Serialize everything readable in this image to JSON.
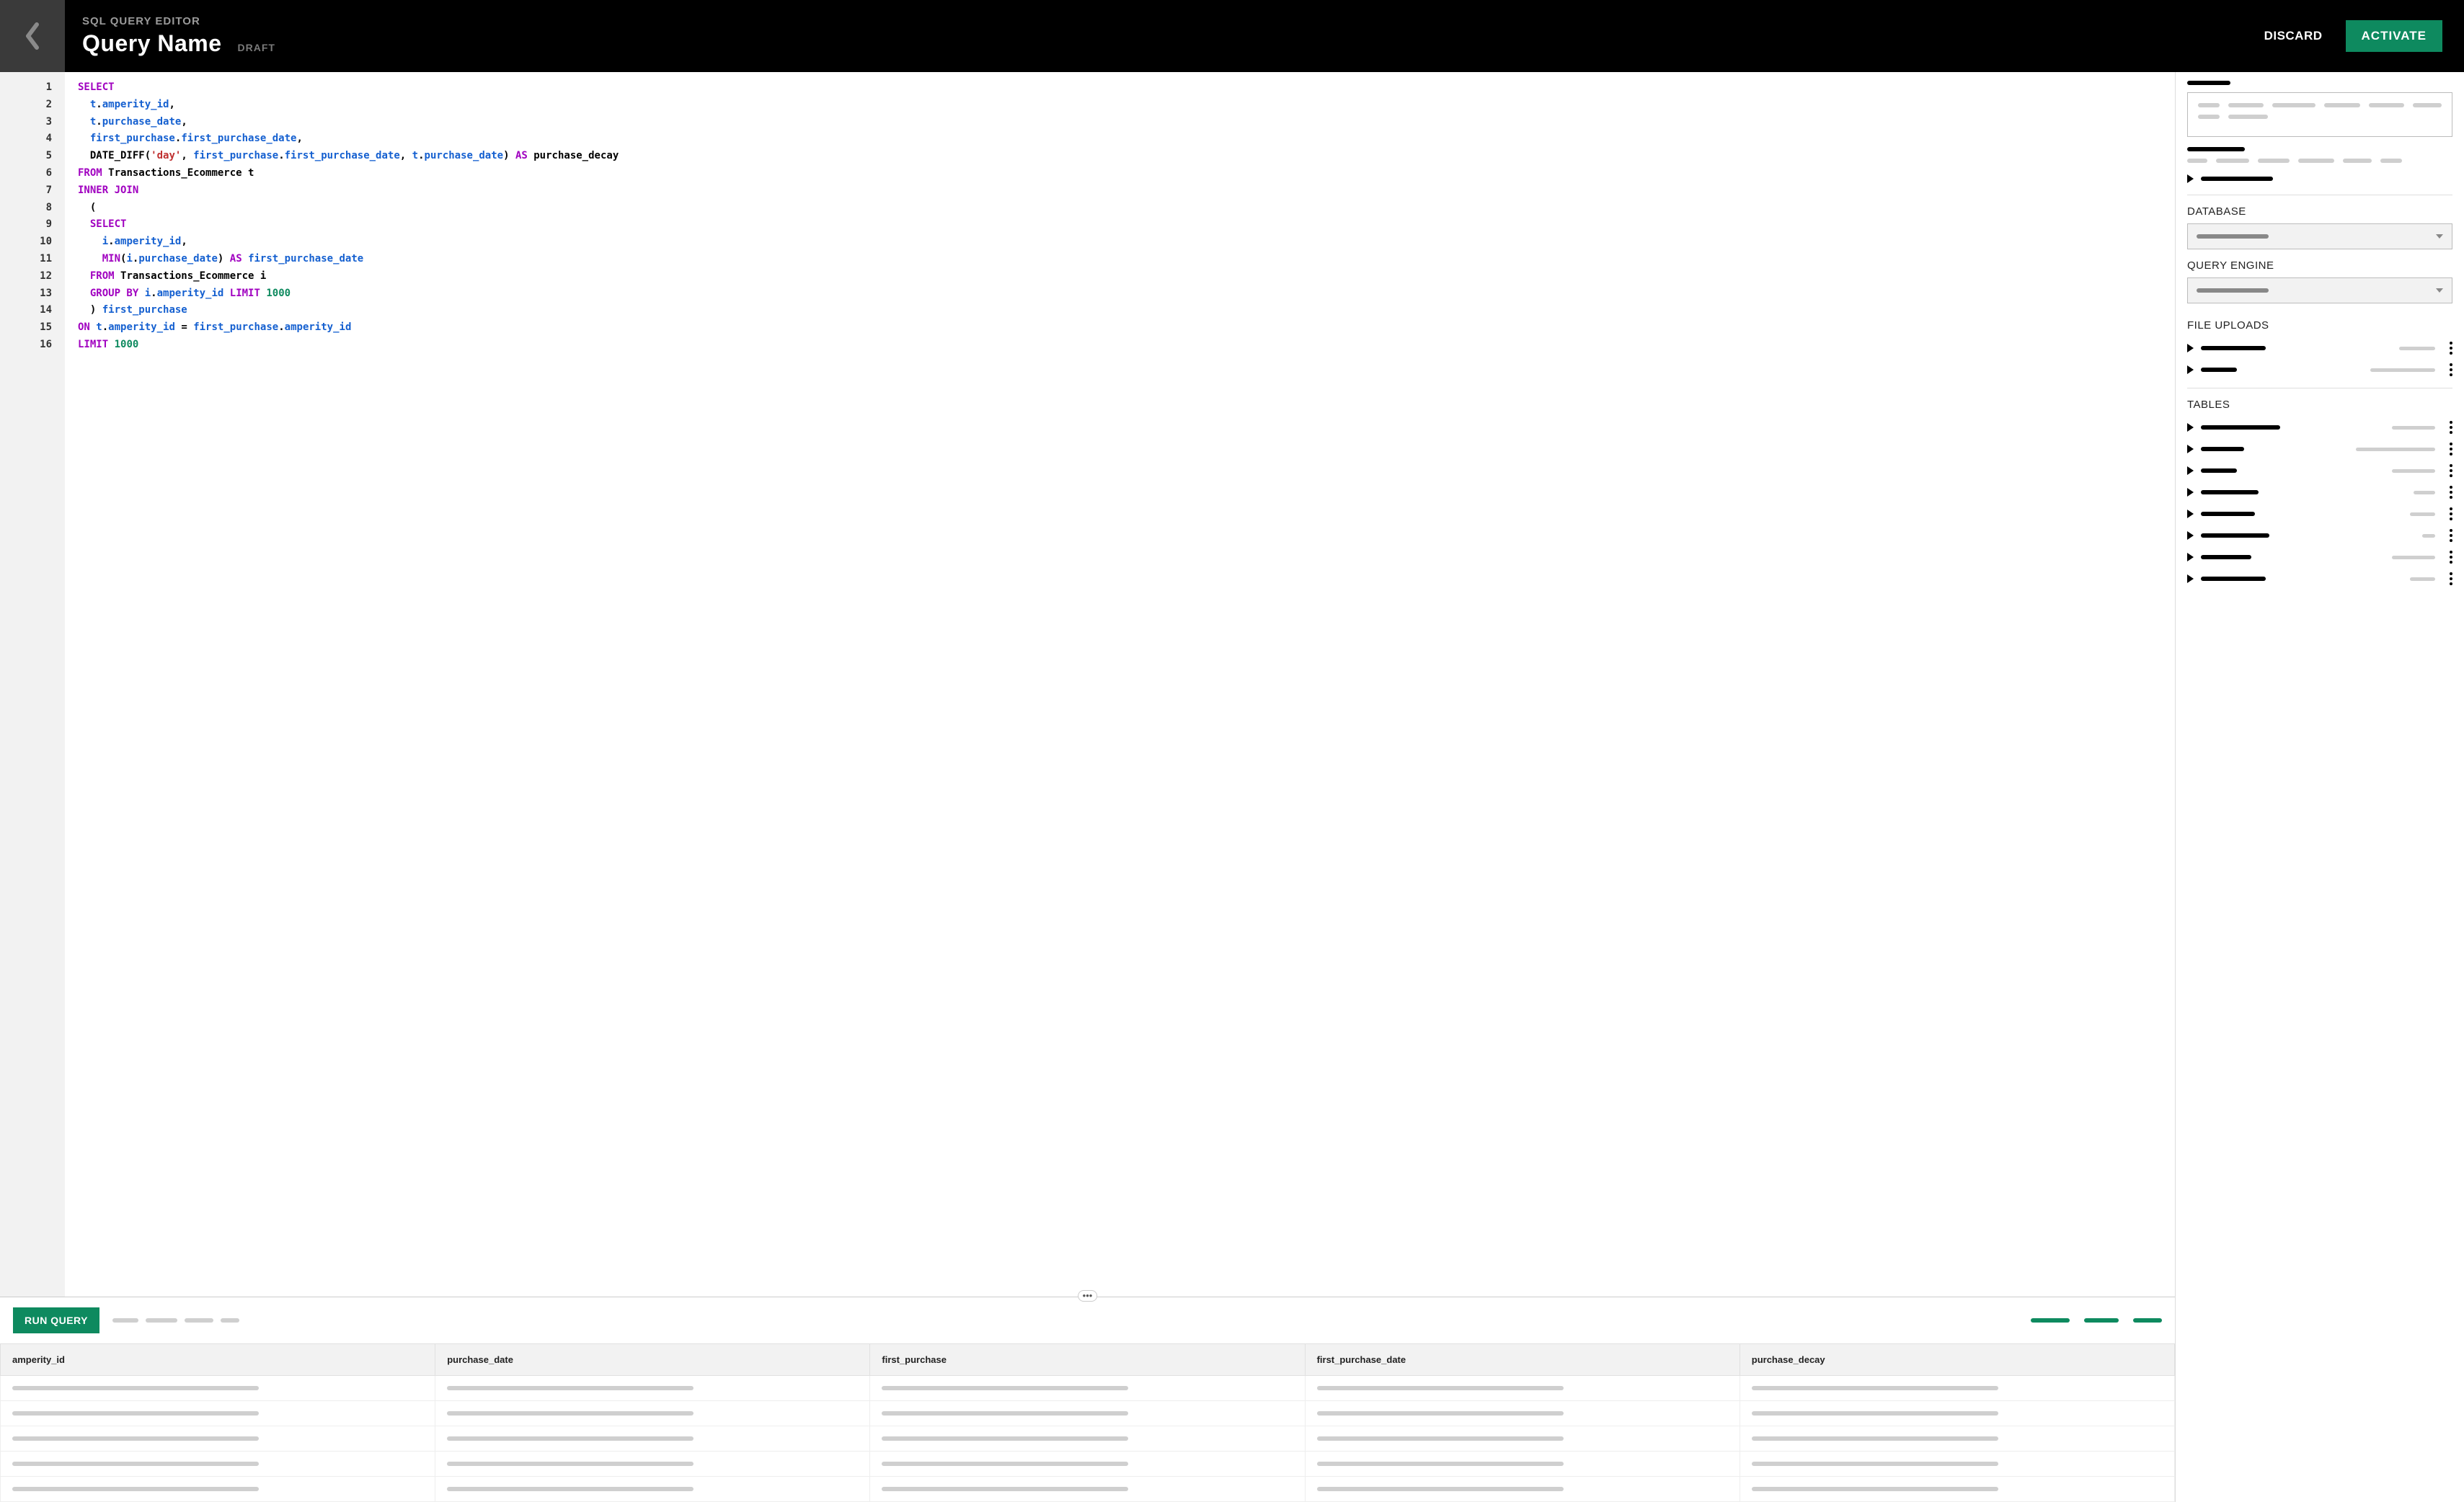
{
  "header": {
    "breadcrumb": "SQL QUERY EDITOR",
    "title": "Query Name",
    "status": "DRAFT",
    "discard": "DISCARD",
    "activate": "ACTIVATE"
  },
  "code_lines": [
    [
      [
        "kw",
        "SELECT"
      ]
    ],
    [
      [
        "plain",
        "  "
      ],
      [
        "col",
        "t"
      ],
      [
        "op",
        "."
      ],
      [
        "col",
        "amperity_id"
      ],
      [
        "op",
        ","
      ]
    ],
    [
      [
        "plain",
        "  "
      ],
      [
        "col",
        "t"
      ],
      [
        "op",
        "."
      ],
      [
        "col",
        "purchase_date"
      ],
      [
        "op",
        ","
      ]
    ],
    [
      [
        "plain",
        "  "
      ],
      [
        "col",
        "first_purchase"
      ],
      [
        "op",
        "."
      ],
      [
        "col",
        "first_purchase_date"
      ],
      [
        "op",
        ","
      ]
    ],
    [
      [
        "plain",
        "  "
      ],
      [
        "fn",
        "DATE_DIFF"
      ],
      [
        "op",
        "("
      ],
      [
        "str",
        "'day'"
      ],
      [
        "op",
        ", "
      ],
      [
        "col",
        "first_purchase"
      ],
      [
        "op",
        "."
      ],
      [
        "col",
        "first_purchase_date"
      ],
      [
        "op",
        ", "
      ],
      [
        "col",
        "t"
      ],
      [
        "op",
        "."
      ],
      [
        "col",
        "purchase_date"
      ],
      [
        "op",
        ") "
      ],
      [
        "kw",
        "AS"
      ],
      [
        "plain",
        " "
      ],
      [
        "fn",
        "purchase_decay"
      ]
    ],
    [
      [
        "kw",
        "FROM"
      ],
      [
        "plain",
        " "
      ],
      [
        "fn",
        "Transactions_Ecommerce t"
      ]
    ],
    [
      [
        "kw",
        "INNER JOIN"
      ]
    ],
    [
      [
        "plain",
        "  "
      ],
      [
        "op",
        "("
      ]
    ],
    [
      [
        "plain",
        "  "
      ],
      [
        "kw",
        "SELECT"
      ]
    ],
    [
      [
        "plain",
        "    "
      ],
      [
        "col",
        "i"
      ],
      [
        "op",
        "."
      ],
      [
        "col",
        "amperity_id"
      ],
      [
        "op",
        ","
      ]
    ],
    [
      [
        "plain",
        "    "
      ],
      [
        "kw",
        "MIN"
      ],
      [
        "op",
        "("
      ],
      [
        "col",
        "i"
      ],
      [
        "op",
        "."
      ],
      [
        "col",
        "purchase_date"
      ],
      [
        "op",
        ") "
      ],
      [
        "kw",
        "AS"
      ],
      [
        "plain",
        " "
      ],
      [
        "col",
        "first_purchase_date"
      ]
    ],
    [
      [
        "plain",
        "  "
      ],
      [
        "kw",
        "FROM"
      ],
      [
        "plain",
        " "
      ],
      [
        "fn",
        "Transactions_Ecommerce i"
      ]
    ],
    [
      [
        "plain",
        "  "
      ],
      [
        "kw",
        "GROUP BY"
      ],
      [
        "plain",
        " "
      ],
      [
        "col",
        "i"
      ],
      [
        "op",
        "."
      ],
      [
        "col",
        "amperity_id"
      ],
      [
        "plain",
        " "
      ],
      [
        "kw",
        "LIMIT"
      ],
      [
        "plain",
        " "
      ],
      [
        "num",
        "1000"
      ]
    ],
    [
      [
        "plain",
        "  "
      ],
      [
        "op",
        ")"
      ],
      [
        "plain",
        " "
      ],
      [
        "col",
        "first_purchase"
      ]
    ],
    [
      [
        "kw",
        "ON"
      ],
      [
        "plain",
        " "
      ],
      [
        "col",
        "t"
      ],
      [
        "op",
        "."
      ],
      [
        "col",
        "amperity_id"
      ],
      [
        "plain",
        " "
      ],
      [
        "op",
        "="
      ],
      [
        "plain",
        " "
      ],
      [
        "col",
        "first_purchase"
      ],
      [
        "op",
        "."
      ],
      [
        "col",
        "amperity_id"
      ]
    ],
    [
      [
        "kw",
        "LIMIT"
      ],
      [
        "plain",
        " "
      ],
      [
        "num",
        "1000"
      ]
    ]
  ],
  "run": {
    "label": "RUN QUERY"
  },
  "columns": [
    "amperity_id",
    "purchase_date",
    "first_purchase",
    "first_purchase_date",
    "purchase_decay"
  ],
  "row_count": 5,
  "side": {
    "database_label": "DATABASE",
    "query_engine_label": "QUERY ENGINE",
    "file_uploads_label": "FILE UPLOADS",
    "tables_label": "TABLES",
    "file_uploads": [
      {
        "w": 90,
        "m": 50
      },
      {
        "w": 50,
        "m": 90
      }
    ],
    "tables": [
      {
        "w": 110,
        "m": 60
      },
      {
        "w": 60,
        "m": 110
      },
      {
        "w": 50,
        "m": 60
      },
      {
        "w": 80,
        "m": 30
      },
      {
        "w": 75,
        "m": 35
      },
      {
        "w": 95,
        "m": 18
      },
      {
        "w": 70,
        "m": 60
      },
      {
        "w": 90,
        "m": 35
      }
    ]
  }
}
